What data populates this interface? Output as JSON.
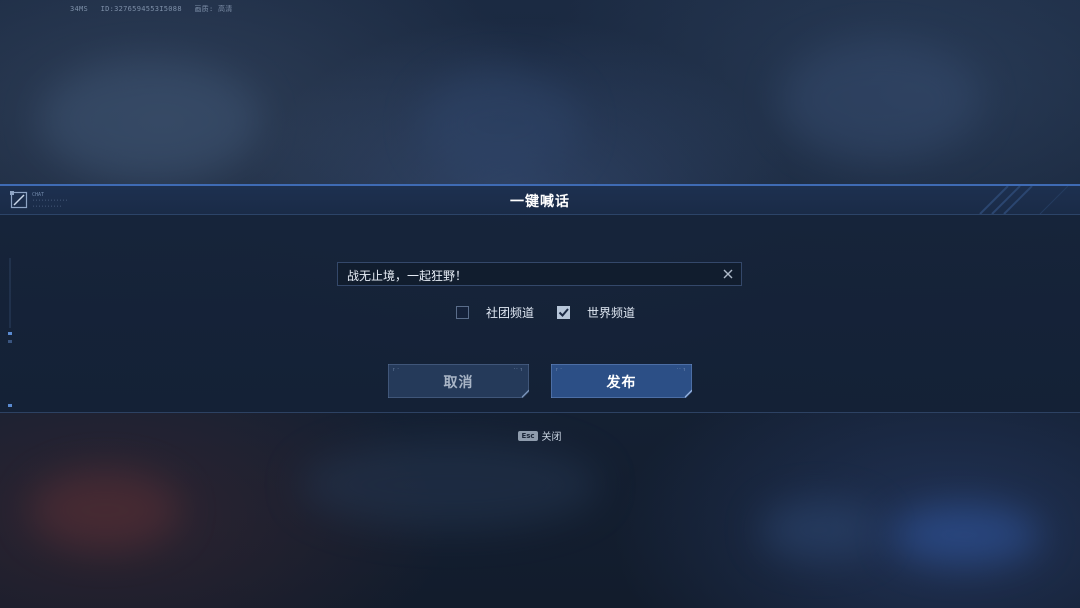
{
  "hud": {
    "ping": "34MS",
    "user_id": "ID:3276594553I5088",
    "quality": "画质: 高清"
  },
  "dialog": {
    "title": "一键喊话",
    "logo_caption": "CHAT"
  },
  "message_input": {
    "value": "战无止境，一起狂野！"
  },
  "channels": [
    {
      "label": "社团频道",
      "checked": false
    },
    {
      "label": "世界频道",
      "checked": true
    }
  ],
  "buttons": {
    "cancel_label": "取消",
    "publish_label": "发布"
  },
  "esc_hint": {
    "key": "Esc",
    "label": "关闭"
  },
  "colors": {
    "accent": "#3f6bb4",
    "publish_button": "#2c4f86",
    "cancel_button": "#253a5a",
    "dialog_bg": "#16243a"
  },
  "icons": {
    "clear": "close-icon",
    "logo": "edit-frame-icon"
  }
}
